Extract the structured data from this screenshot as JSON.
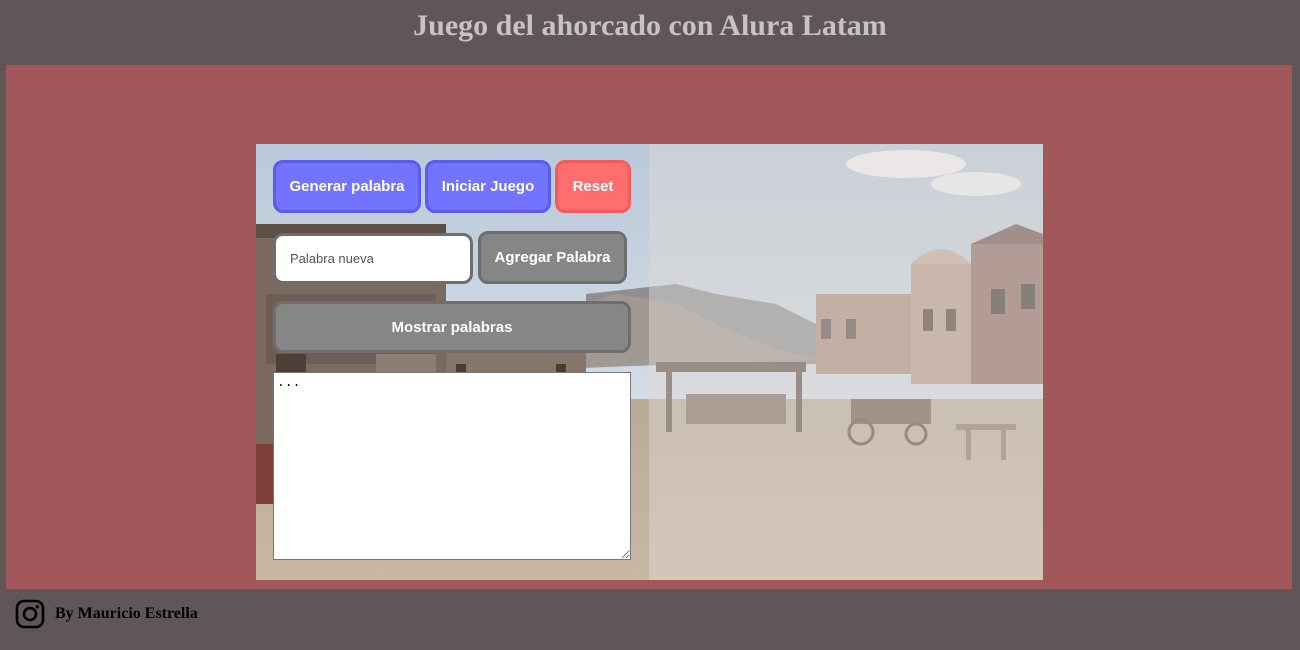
{
  "header": {
    "title": "Juego del ahorcado con Alura Latam"
  },
  "controls": {
    "generate_label": "Generar palabra",
    "start_label": "Iniciar Juego",
    "reset_label": "Reset",
    "new_word_placeholder": "Palabra nueva",
    "new_word_value": "",
    "add_word_label": "Agregar Palabra",
    "show_words_label": "Mostrar palabras",
    "words_text": "..."
  },
  "footer": {
    "author": "By Mauricio Estrella",
    "icon": "instagram-icon"
  },
  "colors": {
    "page_bg": "#5f5657",
    "main_bg": "#a2585a",
    "primary_button": "#7273ff",
    "reset_button": "#ff6e6e",
    "secondary_button": "#868686",
    "title_text": "#c9c2c2"
  }
}
